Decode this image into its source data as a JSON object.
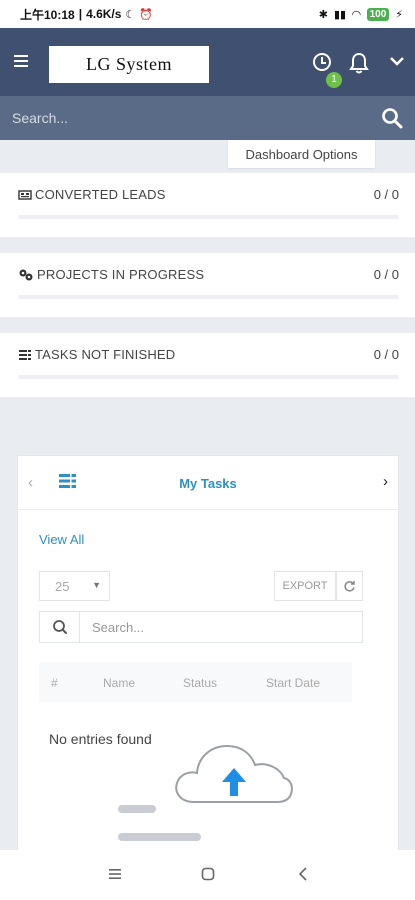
{
  "status_bar": {
    "time": "上午10:18",
    "speed": "4.6K/s",
    "battery": "100"
  },
  "header": {
    "logo_text": "LG System",
    "badge_count": "1"
  },
  "search": {
    "placeholder": "Search..."
  },
  "dashboard_options": "Dashboard Options",
  "stats": [
    {
      "icon": "converted-leads-icon",
      "title": "CONVERTED LEADS",
      "value": "0 / 0",
      "progress": 0
    },
    {
      "icon": "projects-icon",
      "title": "PROJECTS IN PROGRESS",
      "value": "0 / 0",
      "progress": 0
    },
    {
      "icon": "tasks-icon",
      "title": "TASKS NOT FINISHED",
      "value": "0 / 0",
      "progress": 0
    }
  ],
  "tasks_panel": {
    "title": "My Tasks",
    "view_all": "View All",
    "page_size": "25",
    "export_label": "EXPORT",
    "search_placeholder": "Search...",
    "columns": [
      "#",
      "Name",
      "Status",
      "Start Date"
    ],
    "empty_text": "No entries found"
  },
  "colors": {
    "header_bg": "#3f5070",
    "search_bg": "#5a6b87",
    "accent": "#2d8fc5",
    "badge": "#6fc04a",
    "upload_arrow": "#1e8fe6"
  }
}
